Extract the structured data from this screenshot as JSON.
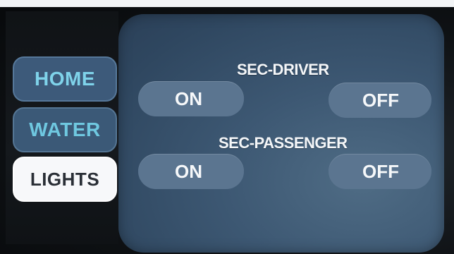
{
  "nav": {
    "home_label": "HOME",
    "water_label": "WATER",
    "lights_label": "LIGHTS",
    "active": "LIGHTS"
  },
  "controls": {
    "driver": {
      "label": "SEC-DRIVER",
      "on_label": "ON",
      "off_label": "OFF"
    },
    "passenger": {
      "label": "SEC-PASSENGER",
      "on_label": "ON",
      "off_label": "OFF"
    }
  },
  "colors": {
    "panel": "#3d5873",
    "button": "#5b7590",
    "nav_text_inactive": "#7fd3ea",
    "nav_active_bg": "#f7f8fa",
    "label_text": "#f4f6f8"
  }
}
